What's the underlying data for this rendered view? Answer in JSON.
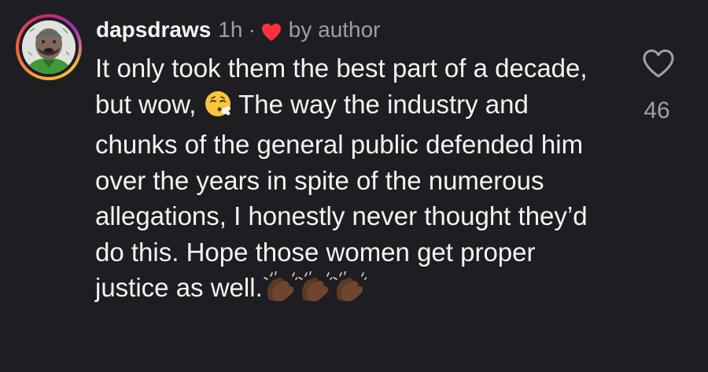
{
  "comment": {
    "username": "dapsdraws",
    "time": "1h",
    "separator": "·",
    "liked_by_author_label": "by author",
    "text_part1": "It only took them the best part of a decade, but wow, ",
    "emoji_exhale_name": "face-exhaling-emoji",
    "text_part2": " The way the industry and chunks of the general public defended him over the years in spite of the numerous allegations, I honestly never thought they’d do this. Hope those women get proper justice as well.",
    "trailing_emojis": [
      "clapping-hands-emoji",
      "clapping-hands-emoji",
      "clapping-hands-emoji"
    ]
  },
  "actions": {
    "like_icon": "heart-outline-icon",
    "like_count": "46"
  },
  "colors": {
    "background": "#1e1e22",
    "text": "#f4f4f6",
    "muted": "#9d9da3",
    "heart_red": "#ff3040"
  }
}
